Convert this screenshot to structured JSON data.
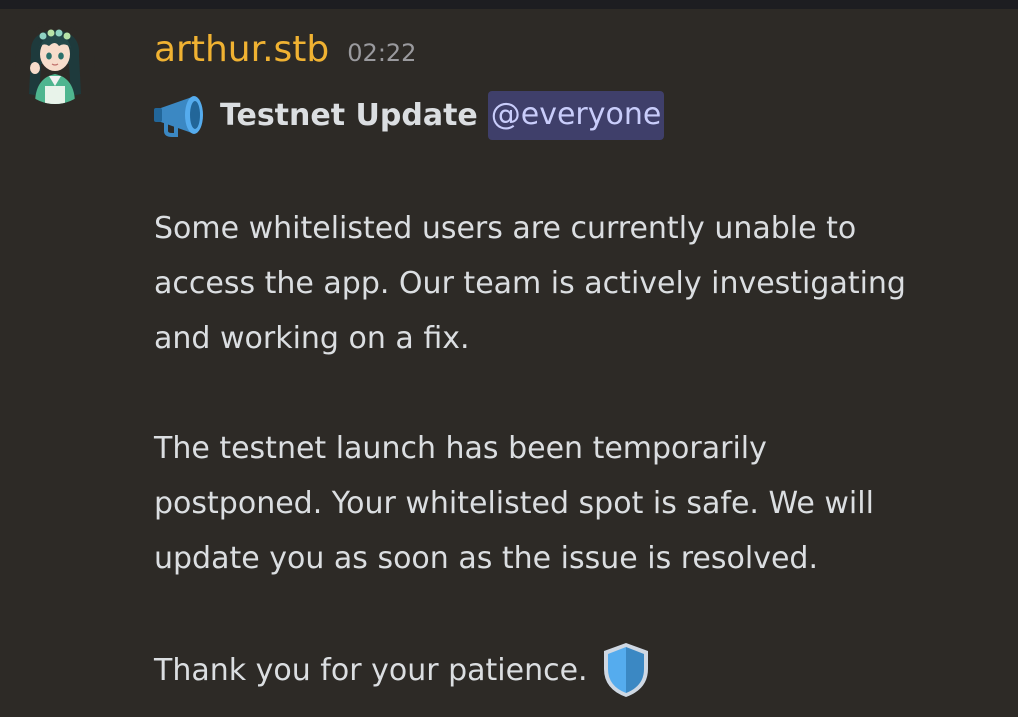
{
  "message": {
    "author": "arthur.stb",
    "timestamp": "02:22",
    "author_color": "#f0b232",
    "title_emoji": "megaphone-icon",
    "title": "Testnet Update",
    "mention": "@everyone",
    "paragraphs": [
      [
        "Some whitelisted users are currently unable to",
        "access the app. Our team is actively investigating",
        "and working on a fix."
      ],
      [
        "The testnet launch has been temporarily",
        "postponed. Your whitelisted spot is safe. We will",
        "update you as soon as the issue is resolved."
      ]
    ],
    "closing": "Thank you for your patience.",
    "closing_emoji": "shield-icon"
  }
}
